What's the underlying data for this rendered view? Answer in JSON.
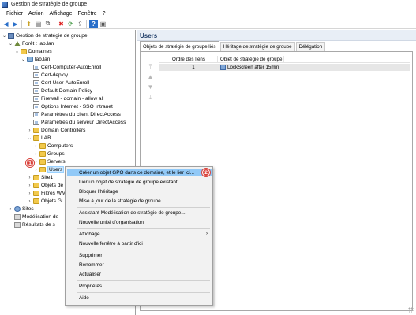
{
  "window": {
    "title": "Gestion de stratégie de groupe"
  },
  "menubar": [
    "Fichier",
    "Action",
    "Affichage",
    "Fenêtre",
    "?"
  ],
  "toolbar": {
    "icons": [
      "back-arrow-icon",
      "forward-arrow-icon",
      "folder-up-icon",
      "show-tree-icon",
      "copy-icon",
      "delete-icon",
      "refresh-icon",
      "export-icon",
      "help-icon",
      "console-icon"
    ],
    "glyphs": [
      "◀",
      "▶",
      "⬆",
      "▤",
      "⧉",
      "✖",
      "⟳",
      "⇪",
      "?",
      "▣"
    ]
  },
  "tree": {
    "root": "Gestion de stratégie de groupe",
    "forest": "Forêt : lab.lan",
    "domains": "Domaines",
    "domain": "lab.lan",
    "gpos": [
      "Cert-Computer-AutoEnroll",
      "Cert-deploy",
      "Cert-User-AutoEnroll",
      "Default Domain Policy",
      "Firewall - domain - allow all",
      "Options Internet - SSO Intranet",
      "Paramètres du client DirectAccess",
      "Paramètres du serveur DirectAccess"
    ],
    "domain_controllers": "Domain Controllers",
    "lab": "LAB",
    "lab_children": [
      "Computers",
      "Groups",
      "Servers",
      "Users"
    ],
    "site1": "Site1",
    "partial_items": [
      "Objets de",
      "Filtres WM",
      "Objets Gl"
    ],
    "sites": "Sites",
    "modeling": "Modélisation de",
    "results": "Résultats de s"
  },
  "badges": {
    "one": "1",
    "two": "2"
  },
  "right_pane": {
    "title": "Users",
    "tabs": [
      "Objets de stratégie de groupe liés",
      "Héritage de stratégie de groupe",
      "Délégation"
    ],
    "columns": [
      "Ordre des liens",
      "Objet de stratégie de groupe"
    ],
    "rows": [
      {
        "order": "1",
        "gpo": "LockScreen after 15min"
      }
    ]
  },
  "context_menu": {
    "items": [
      {
        "label": "Créer un objet GPO dans ce domaine, et le lier ici...",
        "highlight": true
      },
      {
        "label": "Lier un objet de stratégie de groupe existant..."
      },
      {
        "label": "Bloquer l'héritage"
      },
      {
        "label": "Mise à jour de la stratégie de groupe..."
      },
      {
        "label": "Assistant Modélisation de stratégie de groupe..."
      },
      {
        "label": "Nouvelle unité d'organisation"
      },
      {
        "label": "Affichage",
        "submenu": true
      },
      {
        "label": "Nouvelle fenêtre à partir d'ici"
      },
      {
        "label": "Supprimer"
      },
      {
        "label": "Renommer"
      },
      {
        "label": "Actualiser"
      },
      {
        "label": "Propriétés"
      },
      {
        "label": "Aide"
      }
    ]
  }
}
